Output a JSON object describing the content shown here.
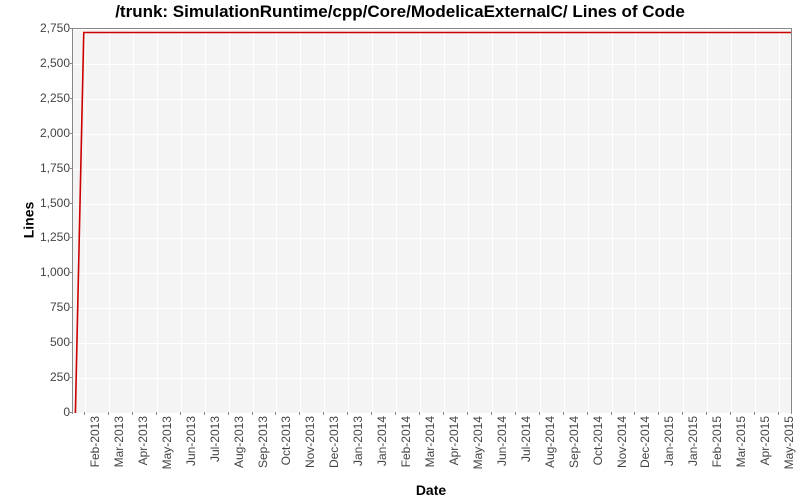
{
  "chart_data": {
    "type": "line",
    "title": "/trunk: SimulationRuntime/cpp/Core/ModelicaExternalC/ Lines of Code",
    "xlabel": "Date",
    "ylabel": "Lines",
    "ylim": [
      0,
      2750
    ],
    "yticks": [
      0,
      250,
      500,
      750,
      1000,
      1250,
      1500,
      1750,
      2000,
      2250,
      2500,
      2750
    ],
    "x_categories": [
      "Feb-2013",
      "Mar-2013",
      "Apr-2013",
      "May-2013",
      "Jun-2013",
      "Jul-2013",
      "Aug-2013",
      "Sep-2013",
      "Oct-2013",
      "Nov-2013",
      "Dec-2013",
      "Jan-2013",
      "Jan-2014",
      "Feb-2014",
      "Mar-2014",
      "Apr-2014",
      "May-2014",
      "Jun-2014",
      "Jul-2014",
      "Aug-2014",
      "Sep-2014",
      "Oct-2014",
      "Nov-2014",
      "Dec-2014",
      "Jan-2015",
      "Jan-2015",
      "Feb-2015",
      "Mar-2015",
      "Apr-2015",
      "May-2015"
    ],
    "series": [
      {
        "name": "lines",
        "color": "#cc0000",
        "points": [
          {
            "x": "Feb-2013-early",
            "y": 0
          },
          {
            "x": "Feb-2013",
            "y": 2725
          },
          {
            "x": "May-2015",
            "y": 2725
          }
        ]
      }
    ]
  }
}
